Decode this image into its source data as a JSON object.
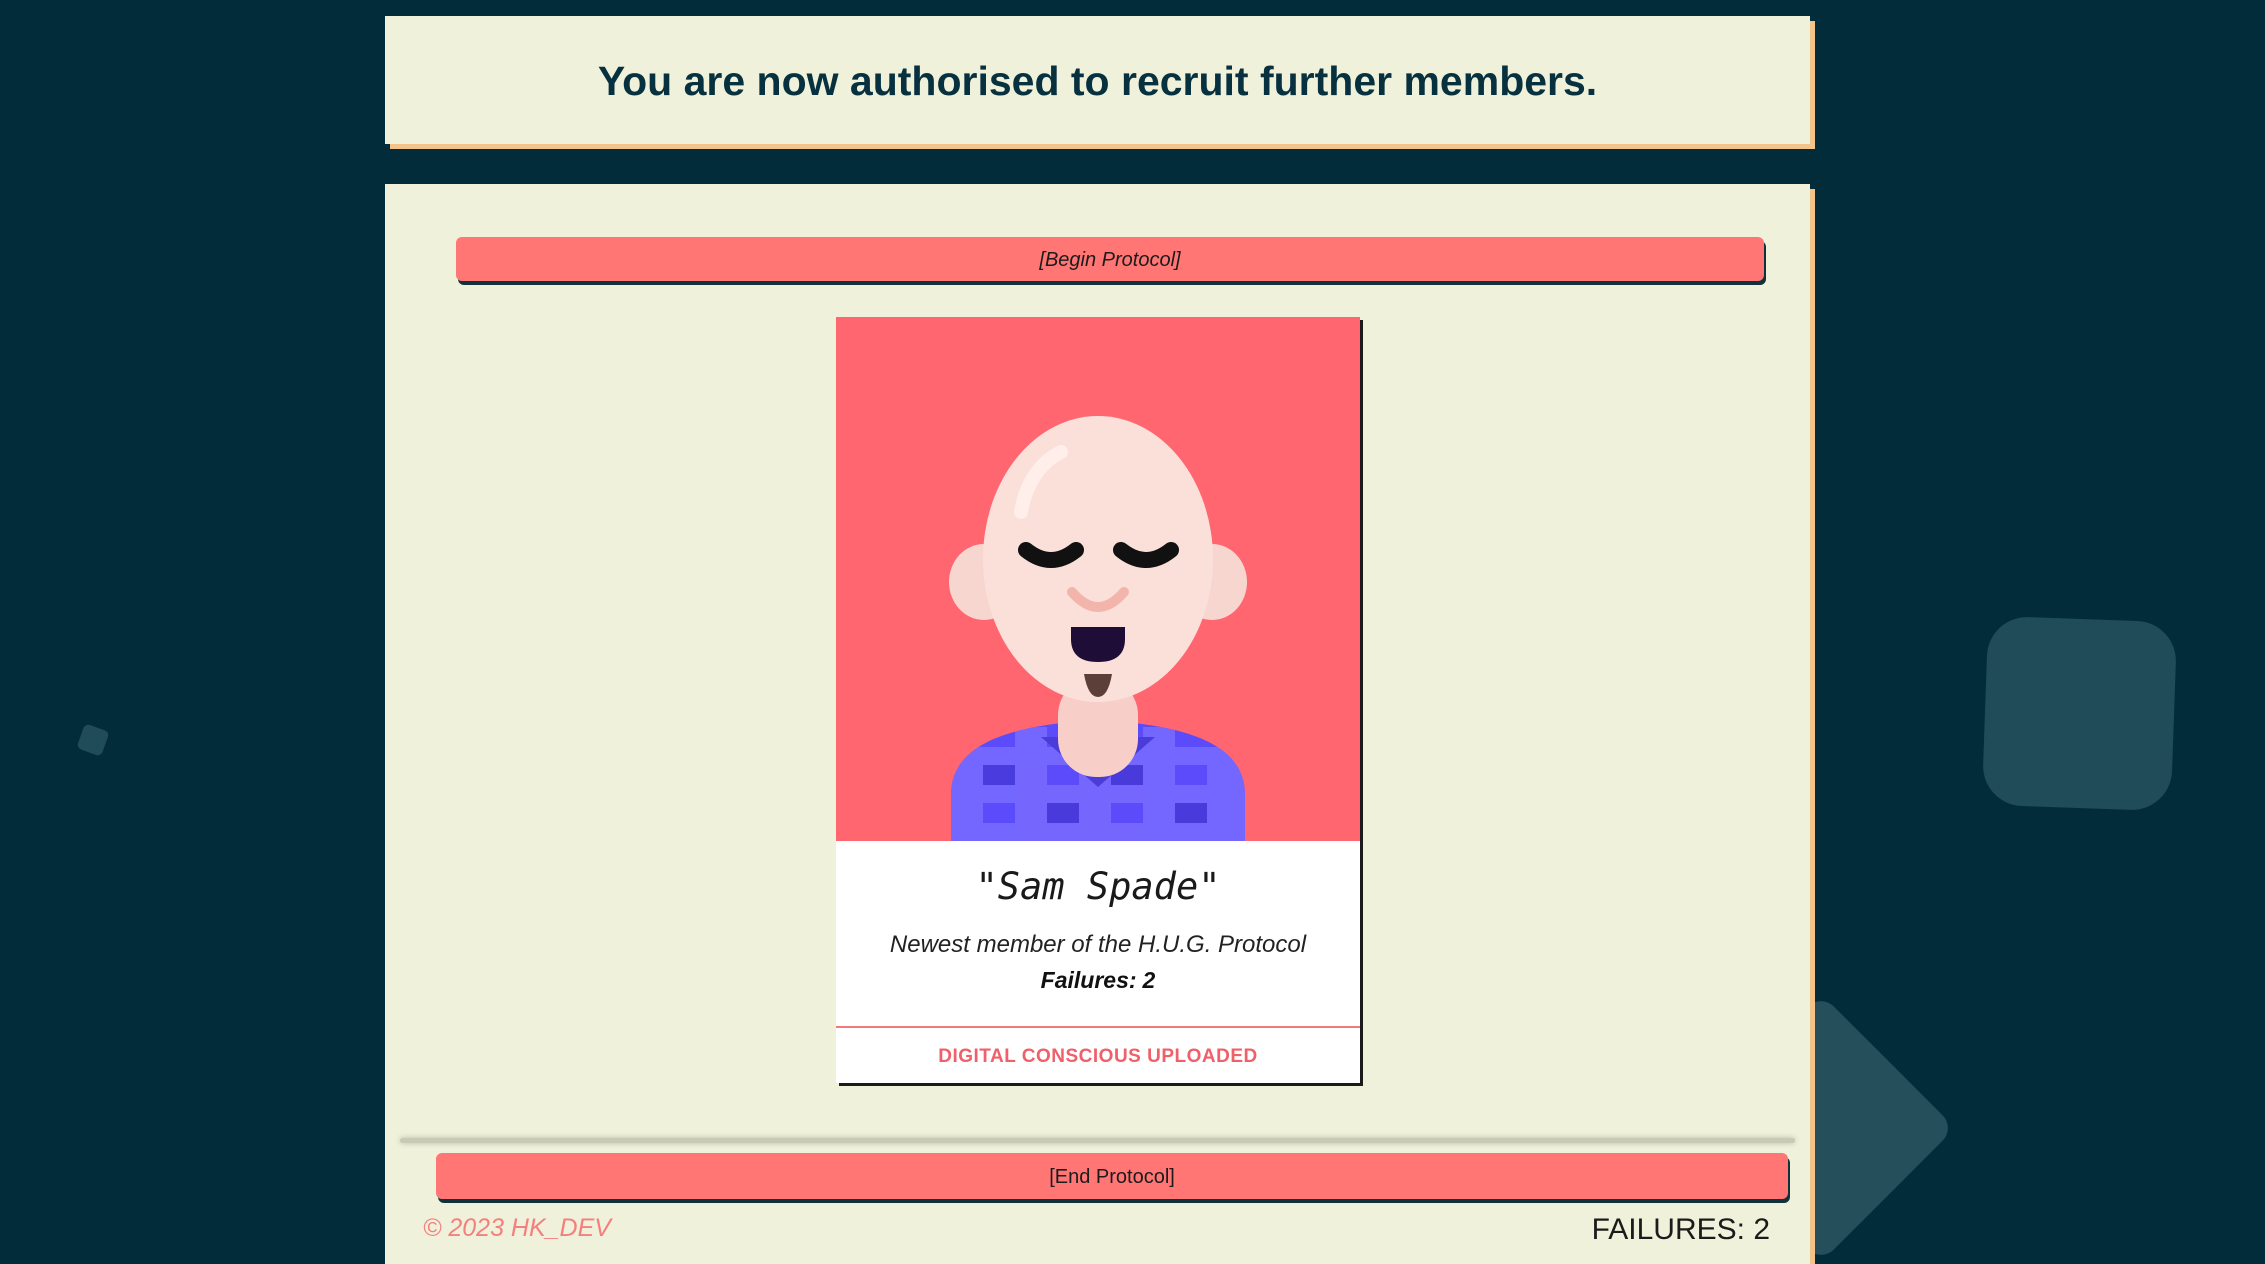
{
  "header": {
    "message": "You are now authorised to recruit further members."
  },
  "protocol": {
    "begin_label": "[Begin Protocol]",
    "end_label": "[End Protocol]"
  },
  "member_card": {
    "name": "\"Sam Spade\"",
    "description": "Newest member of the H.U.G. Protocol",
    "failures_label": "Failures:",
    "failures_value": "2",
    "status": "DIGITAL CONSCIOUS UPLOADED",
    "avatar_icon": "bald-avatar-illustration",
    "avatar_background": "#ff6670"
  },
  "footer": {
    "copyright": "© 2023 HK_DEV",
    "failures_label": "FAILURES:",
    "failures_value": "2"
  },
  "colors": {
    "page_background": "#022c3a",
    "panel_background": "#eff1da",
    "panel_shadow": "#f4c38a",
    "button_background": "#ff7675",
    "accent_text": "#f0606a"
  }
}
